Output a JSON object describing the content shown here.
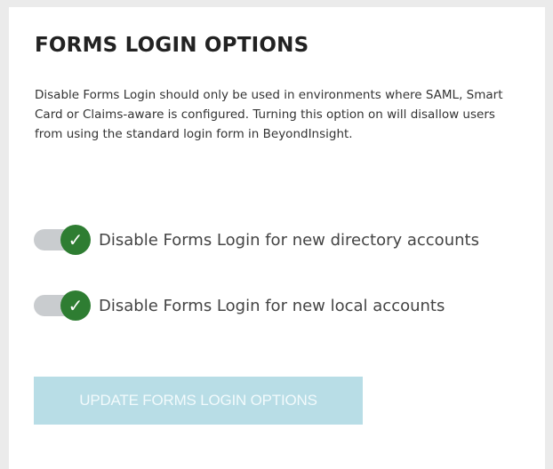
{
  "section": {
    "title": "FORMS LOGIN OPTIONS",
    "description": "Disable Forms Login should only be used in environments where SAML, Smart Card or Claims-aware is configured. Turning this option on will disallow users from using the standard login form in BeyondInsight."
  },
  "toggles": [
    {
      "label": "Disable Forms Login for new directory accounts",
      "checked": true,
      "icon": "check-icon"
    },
    {
      "label": "Disable Forms Login for new local accounts",
      "checked": true,
      "icon": "check-icon"
    }
  ],
  "button": {
    "label": "UPDATE FORMS LOGIN OPTIONS",
    "disabled": true
  },
  "colors": {
    "toggle_on": "#2e7d32",
    "toggle_track": "#c9cccf",
    "button_disabled_bg": "#b8dde6"
  }
}
